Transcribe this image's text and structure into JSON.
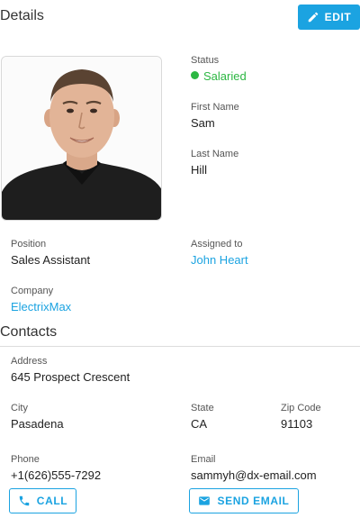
{
  "header": {
    "title": "Details",
    "edit_label": "EDIT"
  },
  "profile": {
    "status_label": "Status",
    "status_value": "Salaried",
    "first_name_label": "First Name",
    "first_name_value": "Sam",
    "last_name_label": "Last Name",
    "last_name_value": "Hill",
    "position_label": "Position",
    "position_value": "Sales Assistant",
    "assigned_label": "Assigned to",
    "assigned_value": "John Heart",
    "company_label": "Company",
    "company_value": "ElectrixMax"
  },
  "contacts": {
    "title": "Contacts",
    "address_label": "Address",
    "address_value": "645 Prospect Crescent",
    "city_label": "City",
    "city_value": "Pasadena",
    "state_label": "State",
    "state_value": "CA",
    "zip_label": "Zip Code",
    "zip_value": "91103",
    "phone_label": "Phone",
    "phone_value": "+1(626)555-7292",
    "email_label": "Email",
    "email_value": "sammyh@dx-email.com",
    "call_label": "CALL",
    "send_email_label": "SEND EMAIL"
  },
  "colors": {
    "accent": "#1ba3e1",
    "status": "#2cb742"
  },
  "icons": {
    "edit": "pencil-icon",
    "call": "phone-icon",
    "email": "mail-icon"
  }
}
